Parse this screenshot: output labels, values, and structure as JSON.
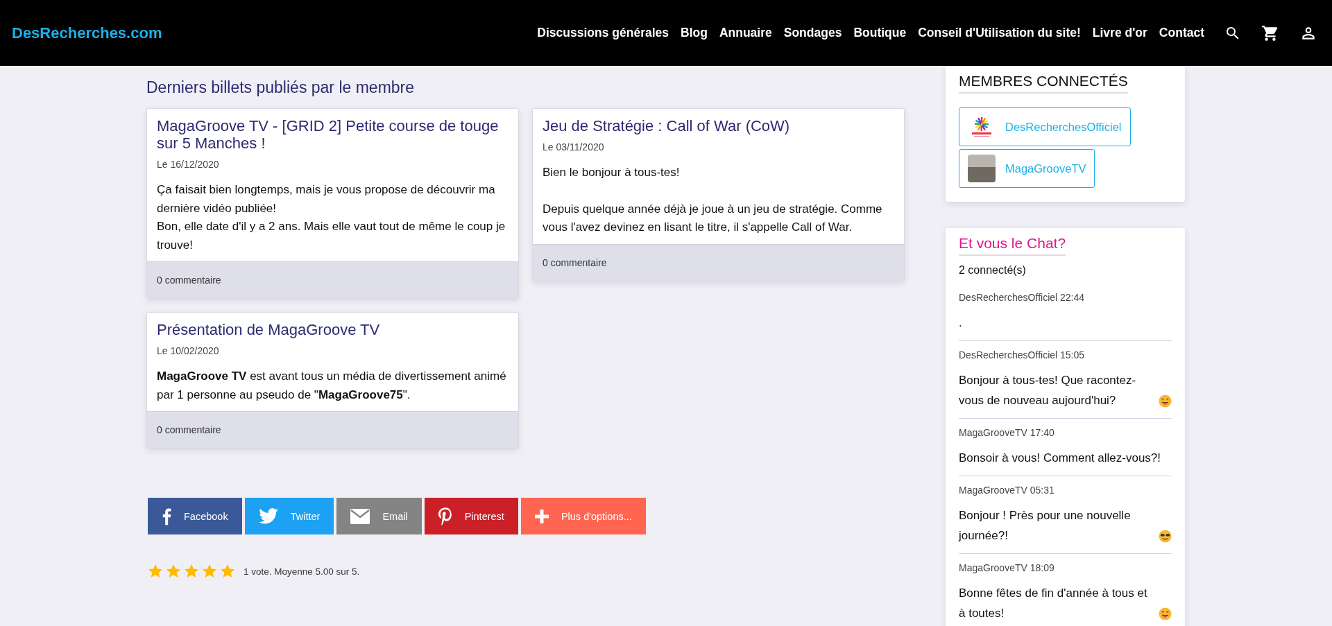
{
  "header": {
    "logo": "DesRecherches.com",
    "nav": [
      {
        "label": "Discussions générales"
      },
      {
        "label": "Blog"
      },
      {
        "label": "Annuaire"
      },
      {
        "label": "Sondages"
      },
      {
        "label": "Boutique"
      },
      {
        "label": "Conseil d'Utilisation du site!"
      },
      {
        "label": "Livre d'or"
      },
      {
        "label": "Contact"
      }
    ]
  },
  "posts_section": {
    "title": "Derniers billets publiés par le membre",
    "posts": [
      {
        "title": "MagaGroove TV - [GRID 2] Petite course de touge sur 5 Manches !",
        "date": "Le 16/12/2020",
        "paragraphs": [
          "Ça faisait bien longtemps, mais je vous propose de découvrir ma dernière vidéo publiée!\nBon, elle date d'il y a 2 ans. Mais elle vaut tout de même le coup je trouve!"
        ],
        "comments": "0 commentaire"
      },
      {
        "title": "Jeu de Stratégie : Call of War (CoW)",
        "date": "Le 03/11/2020",
        "paragraphs": [
          "Bien le bonjour à tous-tes!",
          "Depuis quelque année déjà je joue à un jeu de stratégie. Comme vous l'avez devinez en lisant le titre, il s'appelle Call of War."
        ],
        "comments": "0 commentaire"
      },
      {
        "title": "Présentation de MagaGroove TV",
        "date": "Le 10/02/2020",
        "paragraphs": [
          "**MagaGroove TV** est avant tous un média de divertissement animé par 1 personne au pseudo de \"**MagaGroove75**\"."
        ],
        "comments": "0 commentaire"
      }
    ]
  },
  "share_buttons": [
    {
      "kind": "facebook",
      "label": "Facebook"
    },
    {
      "kind": "twitter",
      "label": "Twitter"
    },
    {
      "kind": "email",
      "label": "Email"
    },
    {
      "kind": "pinterest",
      "label": "Pinterest"
    },
    {
      "kind": "more",
      "label": "Plus d'options..."
    }
  ],
  "rating": {
    "stars": 5,
    "text": "1 vote. Moyenne 5.00 sur 5."
  },
  "members_widget": {
    "title": "MEMBRES CONNECTÉS",
    "members": [
      {
        "name": "DesRecherchesOfficiel",
        "kind": "logo"
      },
      {
        "name": "MagaGrooveTV",
        "kind": "photo"
      }
    ]
  },
  "chat_widget": {
    "title": "Et vous le Chat?",
    "count": "2 connecté(s)",
    "messages": [
      {
        "kind": "plain",
        "author": "DesRecherchesOfficiel 22:44",
        "text": "."
      },
      {
        "kind": "grin",
        "author": "DesRecherchesOfficiel 15:05",
        "text": "Bonjour à tous-tes! Que racontez-vous de nouveau aujourd'hui?"
      },
      {
        "kind": "plain",
        "author": "MagaGrooveTV 17:40",
        "text": "Bonsoir à vous! Comment allez-vous?!"
      },
      {
        "kind": "cool",
        "author": "MagaGrooveTV 05:31",
        "text": "Bonjour ! Près pour une nouvelle journée?!"
      },
      {
        "kind": "grin",
        "author": "MagaGrooveTV 18:09",
        "text": "Bonne fêtes de fin d'année à tous et à toutes!"
      }
    ]
  }
}
